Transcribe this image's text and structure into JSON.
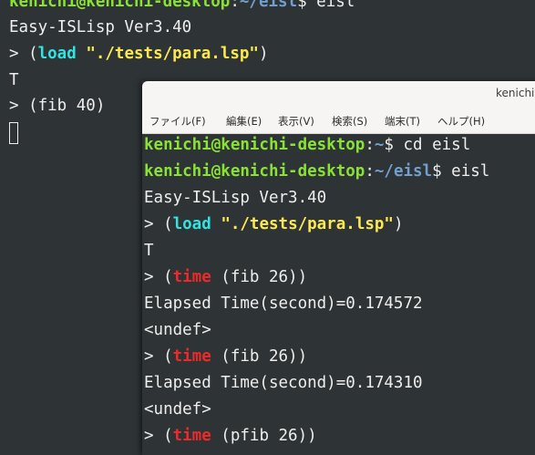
{
  "back_terminal": {
    "line0_user": "kenichi@kenichi-desktop",
    "line0_sep": ":",
    "line0_path": "~/eisl",
    "line0_cmd": "$ eisl",
    "line1": "Easy-ISLisp Ver3.40",
    "line2_prompt": "> (",
    "line2_fn": "load",
    "line2_space": " ",
    "line2_str": "\"./tests/para.lsp\"",
    "line2_close": ")",
    "line3": "T",
    "line4": "> (fib 40)"
  },
  "front_window": {
    "title": "kenichi",
    "menu": [
      {
        "label": "ファイル(F)"
      },
      {
        "label": "編集(E)"
      },
      {
        "label": "表示(V)"
      },
      {
        "label": "検索(S)"
      },
      {
        "label": "端末(T)"
      },
      {
        "label": "ヘルプ(H)"
      }
    ],
    "lines": {
      "l0_user": "kenichi@kenichi-desktop",
      "l0_sep": ":",
      "l0_path": "~",
      "l0_cmd": "$ cd eisl",
      "l1_user": "kenichi@kenichi-desktop",
      "l1_sep": ":",
      "l1_path": "~/eisl",
      "l1_cmd": "$ eisl",
      "l2": "Easy-ISLisp Ver3.40",
      "l3_prompt": "> (",
      "l3_fn": "load",
      "l3_space": " ",
      "l3_str": "\"./tests/para.lsp\"",
      "l3_close": ")",
      "l4": "T",
      "l5_prompt": "> (",
      "l5_fn": "time",
      "l5_rest": " (fib 26))",
      "l6": "Elapsed Time(second)=0.174572",
      "l7": "<undef>",
      "l8_prompt": "> (",
      "l8_fn": "time",
      "l8_rest": " (fib 26))",
      "l9": "Elapsed Time(second)=0.174310",
      "l10": "<undef>",
      "l11_prompt": "> (",
      "l11_fn": "time",
      "l11_rest": " (pfib 26))"
    }
  },
  "colors": {
    "terminal_bg": "#2e3436",
    "user_green": "#8ae234",
    "path_blue": "#729fcf",
    "fn_cyan": "#34e2e2",
    "string_yellow": "#fce94f",
    "keyword_red": "#ef2929"
  }
}
